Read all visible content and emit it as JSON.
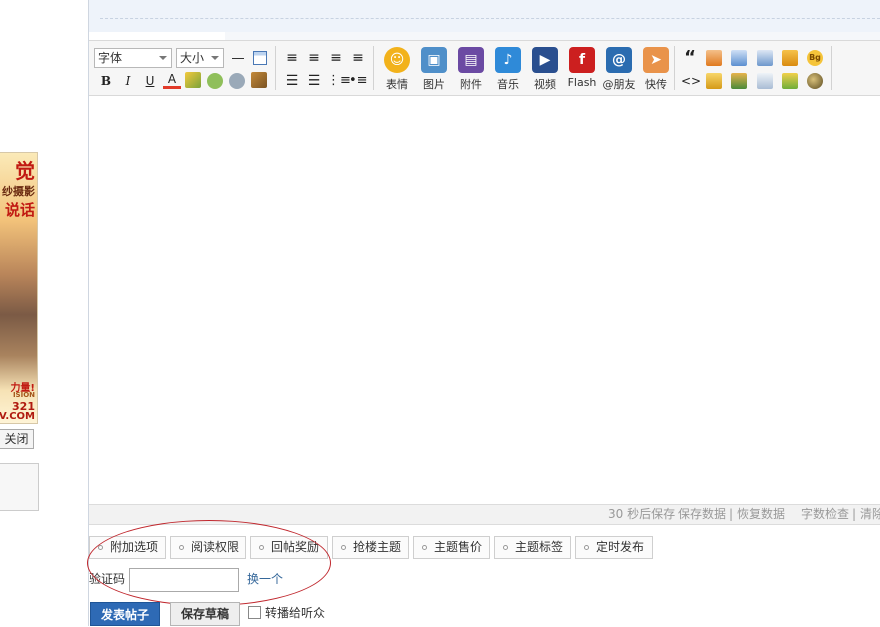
{
  "left_panel": {
    "ad_lines": [
      "觉",
      "纱摄影",
      "说话",
      "力量!",
      "ISION",
      "321",
      "V.COM"
    ],
    "close_label": "关闭"
  },
  "toolbar": {
    "font_select": "字体",
    "size_select": "大小",
    "text_buttons": {
      "bold": "B",
      "italic": "I",
      "underline": "U",
      "color": "A"
    },
    "media": [
      {
        "label": "表情",
        "icon": "smiley-icon",
        "color": "#f2b21b"
      },
      {
        "label": "图片",
        "icon": "image-icon",
        "color": "#4f8fc9"
      },
      {
        "label": "附件",
        "icon": "archive-icon",
        "color": "#6b4aa3"
      },
      {
        "label": "音乐",
        "icon": "music-note-icon",
        "color": "#2f8ad8"
      },
      {
        "label": "视频",
        "icon": "video-icon",
        "color": "#2a4f8f"
      },
      {
        "label": "Flash",
        "icon": "flash-icon",
        "color": "#cc1f1f"
      },
      {
        "label": "@朋友",
        "icon": "at-icon",
        "color": "#2b6cb0"
      },
      {
        "label": "快传",
        "icon": "paper-plane-icon",
        "color": "#e9934a"
      }
    ],
    "quote_glyph": "“",
    "code_glyph": "<>",
    "bg_label": "Bg"
  },
  "status": {
    "autosave": "30 秒后保存",
    "save_data": "保存数据",
    "restore_data": "恢复数据",
    "word_check": "字数检查",
    "clear": "清除",
    "sep": "|"
  },
  "options": [
    "附加选项",
    "阅读权限",
    "回帖奖励",
    "抢楼主题",
    "主题售价",
    "主题标签",
    "定时发布"
  ],
  "captcha": {
    "label": "验证码",
    "refresh": "换一个",
    "value": ""
  },
  "actions": {
    "submit": "发表帖子",
    "draft": "保存草稿",
    "forward": "转播给听众"
  },
  "colors": {
    "accent": "#2e6ab5",
    "ellipse": "#c0282e",
    "link": "#336699"
  }
}
